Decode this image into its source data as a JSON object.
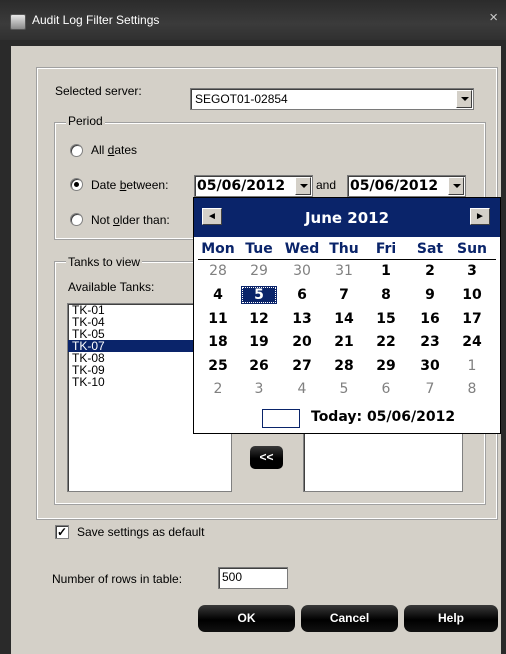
{
  "window": {
    "title": "Audit Log Filter Settings",
    "close_glyph": "×"
  },
  "server": {
    "label": "Selected server:",
    "value": "SEGOT01-02854"
  },
  "period": {
    "label": "Period",
    "all_dates_prefix": "All ",
    "all_dates_ul": "d",
    "all_dates_suffix": "ates",
    "between_prefix": "Date ",
    "between_ul": "b",
    "between_suffix": "etween:",
    "older_prefix": "Not ",
    "older_ul": "o",
    "older_suffix": "lder than:",
    "selected": "between",
    "from_date": "05/06/2012",
    "and_label": "and",
    "to_date": "05/06/2012"
  },
  "tanks": {
    "group_label": "Tanks to view",
    "available_label": "Available Tanks:",
    "available": [
      "TK-01",
      "TK-04",
      "TK-05",
      "TK-07",
      "TK-08",
      "TK-09",
      "TK-10"
    ],
    "selected_index": 3,
    "remove_all_label": "<<"
  },
  "calendar": {
    "month_title": "June 2012",
    "prev_glyph": "◄",
    "next_glyph": "►",
    "weekdays": [
      "Mon",
      "Tue",
      "Wed",
      "Thu",
      "Fri",
      "Sat",
      "Sun"
    ],
    "weeks": [
      [
        "28",
        "29",
        "30",
        "31",
        "1",
        "2",
        "3"
      ],
      [
        "4",
        "5",
        "6",
        "7",
        "8",
        "9",
        "10"
      ],
      [
        "11",
        "12",
        "13",
        "14",
        "15",
        "16",
        "17"
      ],
      [
        "18",
        "19",
        "20",
        "21",
        "22",
        "23",
        "24"
      ],
      [
        "25",
        "26",
        "27",
        "28",
        "29",
        "30",
        "1"
      ],
      [
        "2",
        "3",
        "4",
        "5",
        "6",
        "7",
        "8"
      ]
    ],
    "today_label": "Today: 05/06/2012"
  },
  "save_default": {
    "label": "Save settings as default",
    "checked": true,
    "check_glyph": "✓"
  },
  "rows": {
    "label": "Number of rows in table:",
    "value": "500"
  },
  "buttons": {
    "ok": "OK",
    "cancel": "Cancel",
    "help": "Help"
  }
}
